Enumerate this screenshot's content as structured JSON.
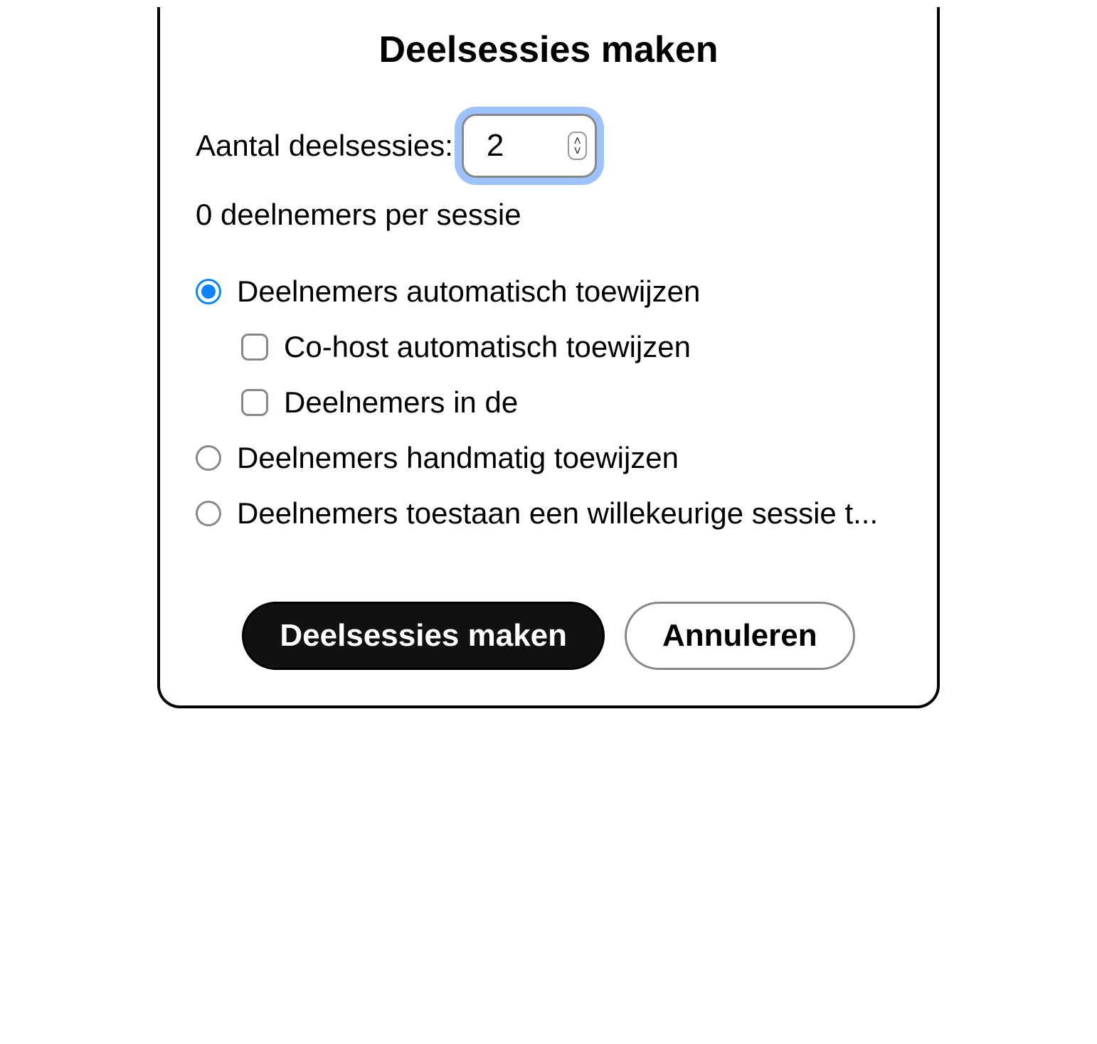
{
  "dialog": {
    "title": "Deelsessies maken",
    "count_label": "Aantal deelsessies:",
    "count_value": "2",
    "participants_per_session": "0 deelnemers per sessie",
    "options": {
      "auto_assign": {
        "label": "Deelnemers automatisch toewijzen",
        "selected": true,
        "sub": {
          "cohost_auto": "Co-host automatisch toewijzen",
          "participants_in": "Deelnemers in de"
        }
      },
      "manual_assign": {
        "label": "Deelnemers handmatig toewijzen",
        "selected": false
      },
      "allow_choose": {
        "label": "Deelnemers toestaan een willekeurige sessie t...",
        "selected": false
      }
    },
    "buttons": {
      "create": "Deelsessies maken",
      "cancel": "Annuleren"
    }
  }
}
